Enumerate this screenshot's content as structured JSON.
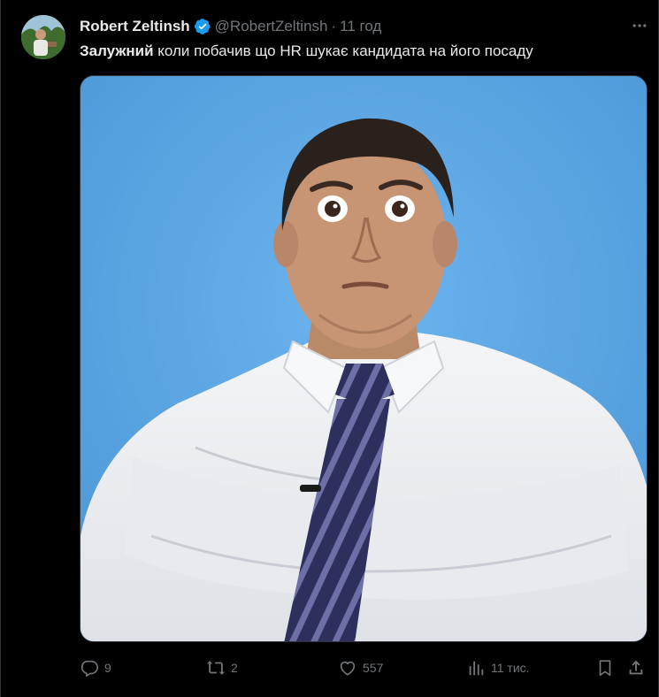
{
  "tweet": {
    "author_name": "Robert Zeltinsh",
    "handle": "@RobertZeltinsh",
    "separator": "·",
    "time": "11 год",
    "text_bold": "Залужний",
    "text_rest": " коли побачив що HR шукає кандидата на його посаду"
  },
  "actions": {
    "replies": "9",
    "reposts": "2",
    "likes": "557",
    "views": "11 тис."
  },
  "colors": {
    "background": "#000000",
    "text_primary": "#e7e9ea",
    "text_secondary": "#71767b",
    "verified_badge": "#1d9bf0",
    "media_background": "#5aa7e6"
  },
  "icons": {
    "verified": "verified-badge-icon",
    "more": "more-horizontal-icon",
    "reply": "reply-bubble-icon",
    "repost": "repost-arrows-icon",
    "like": "heart-icon",
    "views": "bar-chart-icon",
    "bookmark": "bookmark-icon",
    "share": "share-upload-icon"
  }
}
